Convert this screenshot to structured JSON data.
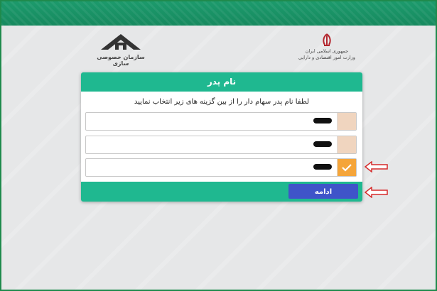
{
  "header": {
    "left_logo_text": "سازمان خصوصی سازی",
    "right_logo_line1": "جمهوری اسلامی ایران",
    "right_logo_line2": "وزارت امور اقتصادی و دارایی"
  },
  "card": {
    "title": "نام پدر",
    "instruction": "لطفا نام پدر سهام دار را از بین گزینه های زیر انتخاب نمایید",
    "options": [
      {
        "label": "",
        "selected": false
      },
      {
        "label": "",
        "selected": false
      },
      {
        "label": "",
        "selected": true
      }
    ],
    "continue_label": "ادامه"
  },
  "colors": {
    "accent": "#1fb890",
    "button": "#3f54c9",
    "check_selected": "#f5a53a",
    "check_unselected": "#f0d5bf",
    "arrow": "#d62a2a"
  }
}
